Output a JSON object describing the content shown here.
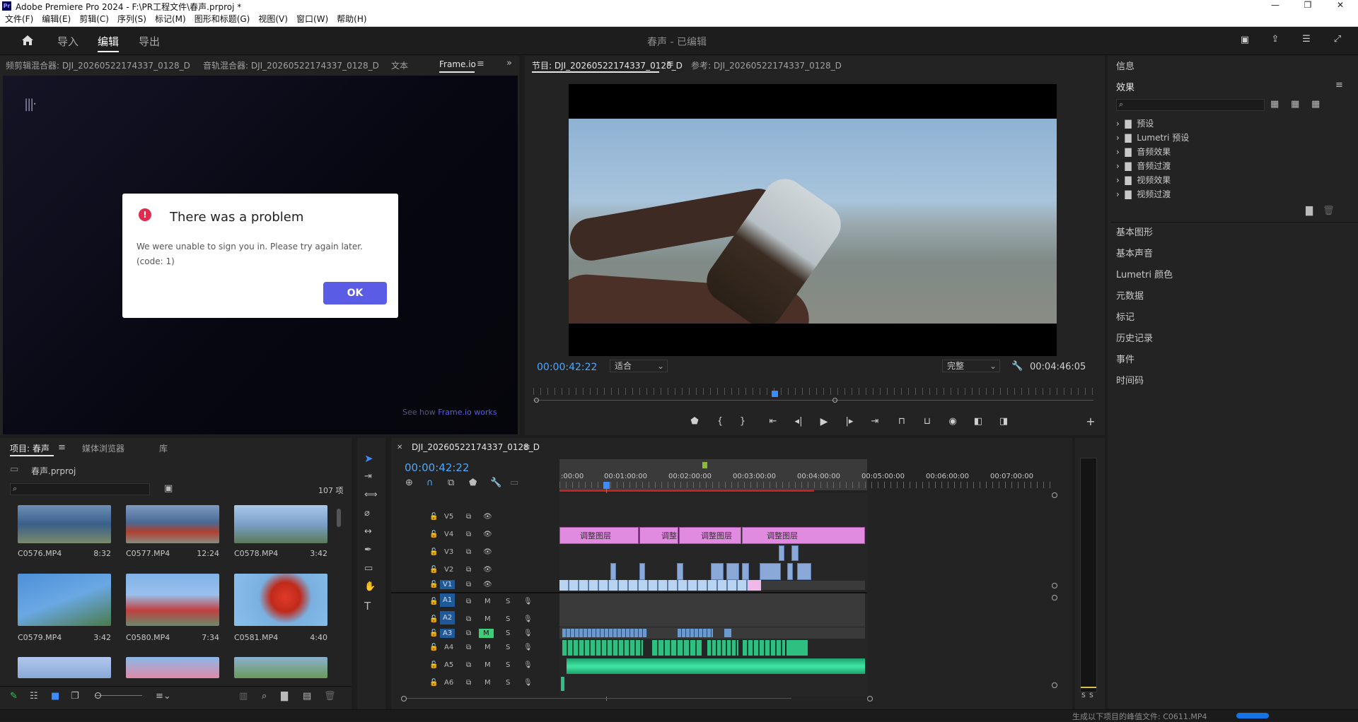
{
  "window": {
    "title": "Adobe Premiere Pro 2024 - F:\\PR工程文件\\春声.prproj *",
    "app_icon": "Pr"
  },
  "menu": [
    "文件(F)",
    "编辑(E)",
    "剪辑(C)",
    "序列(S)",
    "标记(M)",
    "图形和标题(G)",
    "视图(V)",
    "窗口(W)",
    "帮助(H)"
  ],
  "nav": {
    "tabs": [
      "导入",
      "编辑",
      "导出"
    ],
    "active": "编辑",
    "project_status": "春声 - 已编辑"
  },
  "source_panel": {
    "tabs": [
      "频剪辑混合器: DJI_20260522174337_0128_D",
      "音轨混合器: DJI_20260522174337_0128_D",
      "文本",
      "Frame.io"
    ],
    "active_tab": "Frame.io",
    "footer_text": "See how ",
    "footer_link": "Frame.io works"
  },
  "dialog": {
    "title": "There was a problem",
    "message": "We were unable to sign you in. Please try again later.",
    "code": "(code: 1)",
    "ok": "OK",
    "accent": "#5a5ce6"
  },
  "program": {
    "tabs": [
      "节目: DJI_20260522174337_0128_D",
      "参考: DJI_20260522174337_0128_D"
    ],
    "timecode": "00:00:42:22",
    "fit": "适合",
    "quality": "完整",
    "duration": "00:04:46:05",
    "playhead_fraction": 0.43
  },
  "right_panel": {
    "info": "信息",
    "effects": "效果",
    "tree": [
      "预设",
      "Lumetri 预设",
      "音频效果",
      "音频过渡",
      "视频效果",
      "视频过渡"
    ],
    "sections": [
      "基本图形",
      "基本声音",
      "Lumetri 颜色",
      "元数据",
      "标记",
      "历史记录",
      "事件",
      "时间码"
    ]
  },
  "project": {
    "tabs": [
      "项目: 春声",
      "媒体浏览器",
      "库"
    ],
    "file": "春声.prproj",
    "count": "107 项",
    "items": [
      {
        "name": "C0576.MP4",
        "dur": "8:32"
      },
      {
        "name": "C0577.MP4",
        "dur": "12:24"
      },
      {
        "name": "C0578.MP4",
        "dur": "3:42"
      },
      {
        "name": "C0579.MP4",
        "dur": "3:42"
      },
      {
        "name": "C0580.MP4",
        "dur": "7:34"
      },
      {
        "name": "C0581.MP4",
        "dur": "4:40"
      }
    ]
  },
  "timeline": {
    "sequence": "DJI_20260522174337_0128_D",
    "timecode": "00:00:42:22",
    "ruler": [
      ":00:00",
      "00:01:00:00",
      "00:02:00:00",
      "00:03:00:00",
      "00:04:00:00",
      "00:05:00:00",
      "00:06:00:00",
      "00:07:00:00"
    ],
    "video_tracks": [
      "V5",
      "V4",
      "V3",
      "V2",
      "V1"
    ],
    "audio_tracks": [
      "A1",
      "A2",
      "A3",
      "A4",
      "A5",
      "A6"
    ],
    "adjustment_label": "调整图层",
    "mute": "M",
    "solo": "S"
  },
  "meter": {
    "labels": [
      "S",
      "S"
    ]
  },
  "status": {
    "text": "生成以下项目的峰值文件: C0611.MP4"
  }
}
